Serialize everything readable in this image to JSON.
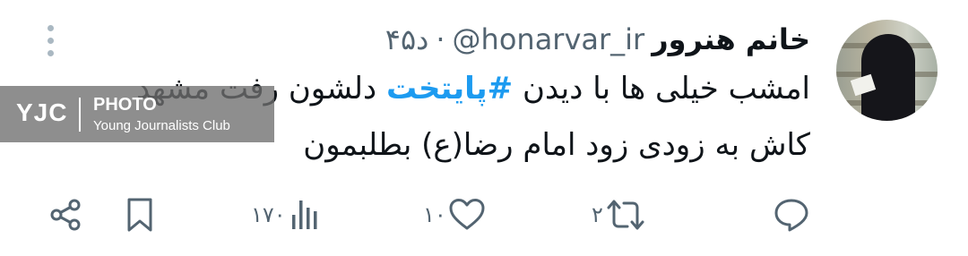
{
  "tweet": {
    "author_name": "خانم هنرور",
    "handle": "@honarvar_ir",
    "time": "۴۵د",
    "separator": "·",
    "text_line1_prefix": "امشب خیلی ها با دیدن",
    "hashtag": "#پایتخت",
    "text_line1_suffix": "دلشون رفت مشهد",
    "text_line2": "کاش به زودی زود امام رضا(ع) بطلبمون"
  },
  "watermark": {
    "brand": "YJC",
    "photo": "PHOTO",
    "club": "Young Journalists Club"
  },
  "actions": {
    "reply_icon": "comment-icon",
    "retweet_icon": "retweet-icon",
    "retweet_count": "۲",
    "like_icon": "heart-icon",
    "like_count": "۱۰",
    "views_icon": "views-icon",
    "views_count": "۱۷۰",
    "bookmark_icon": "bookmark-icon",
    "share_icon": "share-icon"
  },
  "colors": {
    "text": "#0f1419",
    "muted": "#536471",
    "hashtag": "#1d9bf0",
    "more_dots": "#aab8c2"
  }
}
